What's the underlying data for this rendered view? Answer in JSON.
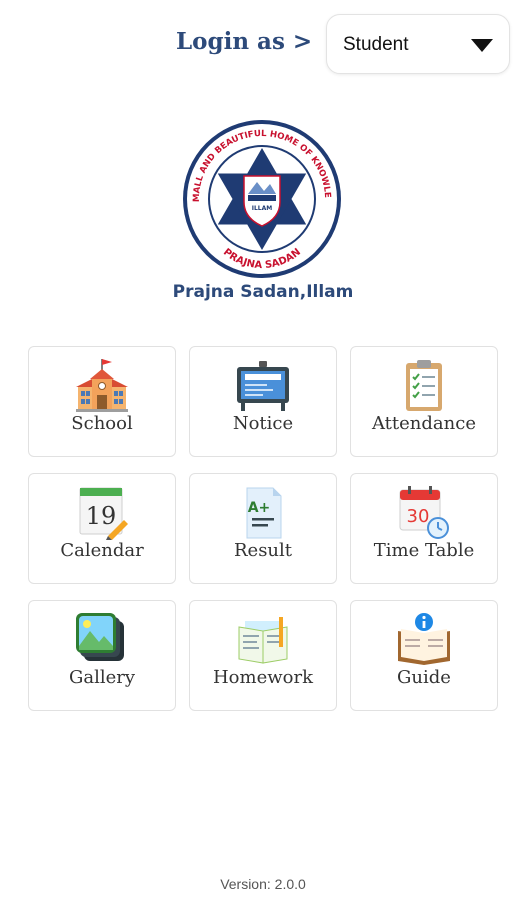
{
  "header": {
    "login_label": "Login as >",
    "role_select": {
      "value": "Student"
    }
  },
  "logo": {
    "ring_text_top": "A SMALL AND BEAUTIFUL HOME OF KNOWLEDGE",
    "ring_text_bottom": "PRAJNA SADAN",
    "emblem_text": "ILLAM"
  },
  "school_name": "Prajna Sadan,Illam",
  "menu": [
    {
      "label": "School",
      "icon": "school-icon"
    },
    {
      "label": "Notice",
      "icon": "notice-board-icon"
    },
    {
      "label": "Attendance",
      "icon": "clipboard-checklist-icon"
    },
    {
      "label": "Calendar",
      "icon": "calendar-icon",
      "icon_text": "19"
    },
    {
      "label": "Result",
      "icon": "result-document-icon",
      "icon_text": "A+"
    },
    {
      "label": "Time Table",
      "icon": "timetable-calendar-icon",
      "icon_text": "30"
    },
    {
      "label": "Gallery",
      "icon": "gallery-icon"
    },
    {
      "label": "Homework",
      "icon": "homework-book-icon"
    },
    {
      "label": "Guide",
      "icon": "guide-book-icon"
    }
  ],
  "footer": {
    "version": "Version: 2.0.0"
  },
  "colors": {
    "brand_blue": "#2d4a7a",
    "logo_red": "#c8102e",
    "tile_border": "#e1e1e1"
  }
}
